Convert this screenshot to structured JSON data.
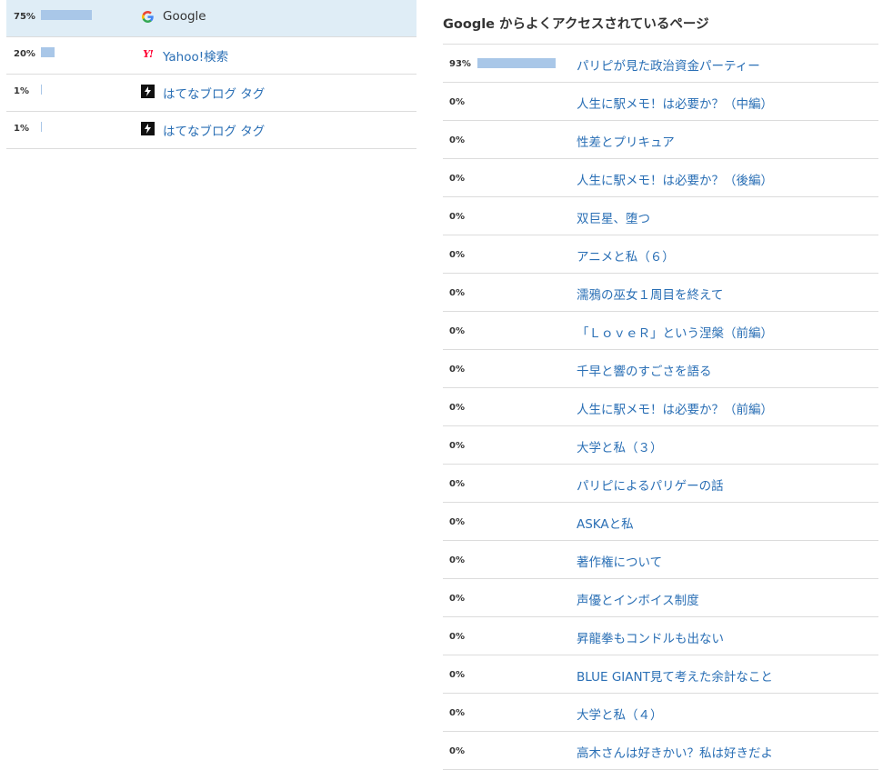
{
  "referrers": [
    {
      "percent_label": "75%",
      "percent": 75,
      "icon": "google-icon",
      "label": "Google",
      "selected": true
    },
    {
      "percent_label": "20%",
      "percent": 20,
      "icon": "yahoo-icon",
      "label": "Yahoo!検索",
      "selected": false
    },
    {
      "percent_label": "1%",
      "percent": 1,
      "icon": "hatena-blog-icon",
      "label": "はてなブログ タグ",
      "selected": false
    },
    {
      "percent_label": "1%",
      "percent": 1,
      "icon": "hatena-blog-icon",
      "label": "はてなブログ タグ",
      "selected": false
    }
  ],
  "top_pages": {
    "title": "Google からよくアクセスされているページ",
    "rows": [
      {
        "percent_label": "93%",
        "percent": 93,
        "title": "パリピが見た政治資金パーティー"
      },
      {
        "percent_label": "0%",
        "percent": 0,
        "title": "人生に駅メモ！は必要か？（中編）"
      },
      {
        "percent_label": "0%",
        "percent": 0,
        "title": "性差とプリキュア"
      },
      {
        "percent_label": "0%",
        "percent": 0,
        "title": "人生に駅メモ！は必要か？（後編）"
      },
      {
        "percent_label": "0%",
        "percent": 0,
        "title": "双巨星、堕つ"
      },
      {
        "percent_label": "0%",
        "percent": 0,
        "title": "アニメと私（６）"
      },
      {
        "percent_label": "0%",
        "percent": 0,
        "title": "濡鴉の巫女１周目を終えて"
      },
      {
        "percent_label": "0%",
        "percent": 0,
        "title": "「ＬｏｖｅＲ」という涅槃（前編）"
      },
      {
        "percent_label": "0%",
        "percent": 0,
        "title": "千早と響のすごさを語る"
      },
      {
        "percent_label": "0%",
        "percent": 0,
        "title": "人生に駅メモ！は必要か？（前編）"
      },
      {
        "percent_label": "0%",
        "percent": 0,
        "title": "大学と私（３）"
      },
      {
        "percent_label": "0%",
        "percent": 0,
        "title": "パリピによるパリゲーの話"
      },
      {
        "percent_label": "0%",
        "percent": 0,
        "title": "ASKAと私"
      },
      {
        "percent_label": "0%",
        "percent": 0,
        "title": "著作権について"
      },
      {
        "percent_label": "0%",
        "percent": 0,
        "title": "声優とインボイス制度"
      },
      {
        "percent_label": "0%",
        "percent": 0,
        "title": "昇龍拳もコンドルも出ない"
      },
      {
        "percent_label": "0%",
        "percent": 0,
        "title": "BLUE GIANT見て考えた余計なこと"
      },
      {
        "percent_label": "0%",
        "percent": 0,
        "title": "大学と私（４）"
      },
      {
        "percent_label": "0%",
        "percent": 0,
        "title": "高木さんは好きかい？私は好きだよ"
      }
    ]
  },
  "colors": {
    "link": "#2a6fb5",
    "bar": "#a9c7e8",
    "selected_row": "#dfedf6"
  }
}
